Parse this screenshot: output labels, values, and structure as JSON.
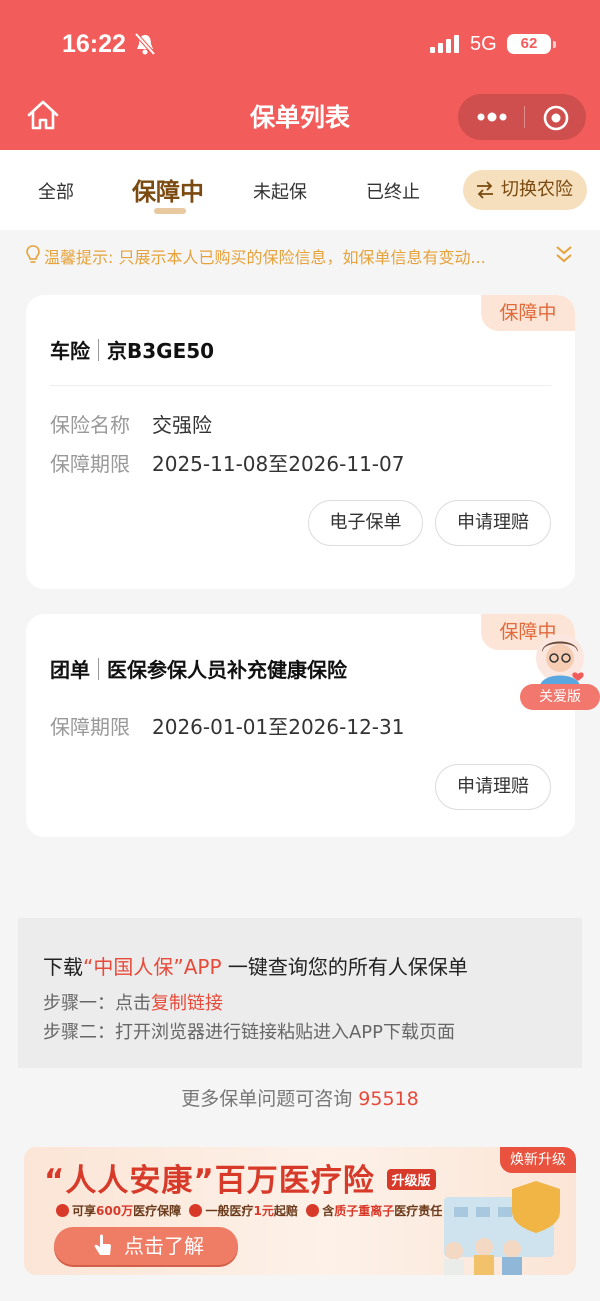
{
  "status_bar": {
    "time": "16:22",
    "network": "5G",
    "battery": "62"
  },
  "nav": {
    "title": "保单列表"
  },
  "tabs": {
    "items": [
      {
        "label": "全部"
      },
      {
        "label": "保障中"
      },
      {
        "label": "未起保"
      },
      {
        "label": "已终止"
      }
    ],
    "active_index": 1,
    "switch_label": "切换农险"
  },
  "tip": {
    "text": "温馨提示: 只展示本人已购买的保险信息，如保单信息有变动..."
  },
  "policies": [
    {
      "badge": "保障中",
      "type": "车险",
      "subject": "京B3GE50",
      "fields": [
        {
          "label": "保险名称",
          "value": "交强险"
        },
        {
          "label": "保障期限",
          "value": "2025-11-08至2026-11-07"
        }
      ],
      "actions": [
        "电子保单",
        "申请理赔"
      ]
    },
    {
      "badge": "保障中",
      "type": "团单",
      "subject": "医保参保人员补充健康保险",
      "fields": [
        {
          "label": "保障期限",
          "value": "2026-01-01至2026-12-31"
        }
      ],
      "actions": [
        "申请理赔"
      ]
    }
  ],
  "care": {
    "label": "关爱版"
  },
  "download": {
    "prefix": "下载",
    "app_name": "“中国人保”APP",
    "suffix": " 一键查询您的所有人保保单",
    "step1_prefix": "步骤一：点击",
    "step1_link": "复制链接",
    "step2": "步骤二：打开浏览器进行链接粘贴进入APP下载页面"
  },
  "consult": {
    "text": "更多保单问题可咨询 ",
    "phone": "95518"
  },
  "banner": {
    "tag": "焕新升级",
    "title": "“人人安康”百万医疗险",
    "version": "升级版",
    "features": [
      {
        "prefix": "可享",
        "highlight": "600万",
        "suffix": "医疗保障"
      },
      {
        "prefix": "一般医疗",
        "highlight": "1元",
        "suffix": "起赔"
      },
      {
        "prefix": "含",
        "highlight": "质子重离子",
        "suffix": "医疗责任"
      }
    ],
    "cta": "点击了解"
  },
  "colors": {
    "brand": "#f25d5b",
    "accent_gold": "#7a4a10",
    "tip": "#e6a23c",
    "link_red": "#e84a3a"
  }
}
